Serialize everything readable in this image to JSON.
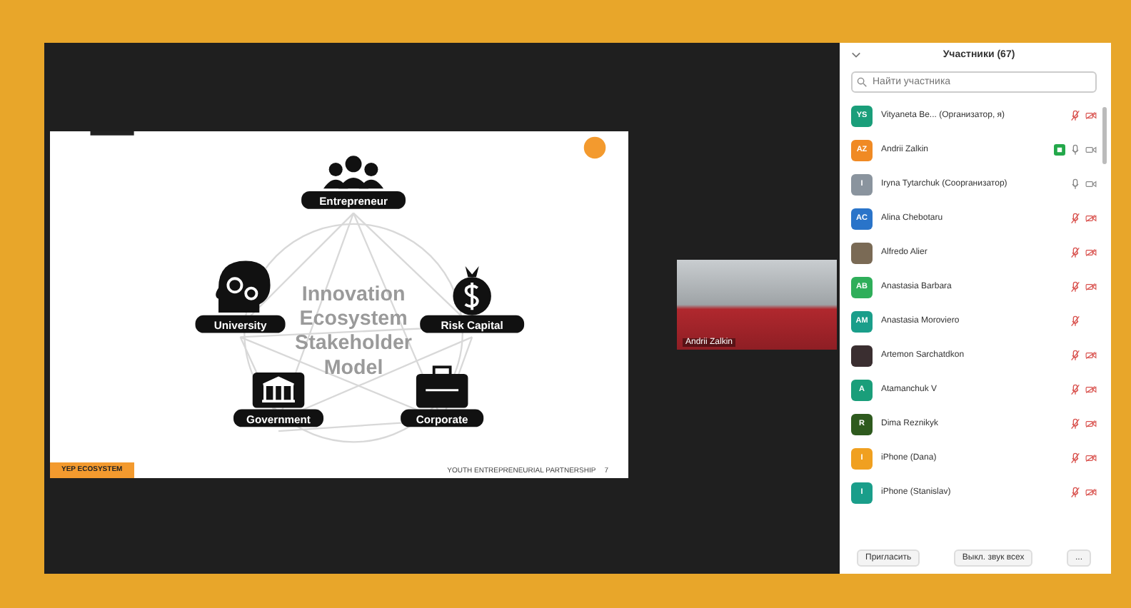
{
  "slide": {
    "title_lines": [
      "Innovation",
      "Ecosystem",
      "Stakeholder",
      "Model"
    ],
    "nodes": [
      {
        "kind": "people",
        "label": "Entrepreneur"
      },
      {
        "kind": "mind",
        "label": "University"
      },
      {
        "kind": "money",
        "label": "Risk Capital"
      },
      {
        "kind": "bank",
        "label": "Government"
      },
      {
        "kind": "case",
        "label": "Corporate"
      }
    ],
    "footer_left": "YEP ECOSYSTEM",
    "footer_right": "YOUTH ENTREPRENEURIAL PARTNERSHIP",
    "page": "7"
  },
  "video": {
    "name": "Andrii Zalkin"
  },
  "participants_panel": {
    "title": "Участники (67)",
    "search": {
      "placeholder": "Найти участника"
    },
    "participants": [
      {
        "initials": "YS",
        "color": "#1a9e7a",
        "name": "Vityaneta Be... (Организатор, я)",
        "sharing": false,
        "muted": true,
        "video_icon": true,
        "video_off": true
      },
      {
        "initials": "AZ",
        "color": "#f08a24",
        "name": "Andrii Zalkin",
        "sharing": true,
        "muted": false,
        "video_icon": true,
        "video_off": false
      },
      {
        "initials": "I",
        "color": "#8a949e",
        "name": "Iryna Tytarchuk (Соорганизатор)",
        "sharing": false,
        "muted": false,
        "video_icon": true,
        "video_off": false
      },
      {
        "initials": "AC",
        "color": "#2a74c9",
        "name": "Alina Chebotaru",
        "sharing": false,
        "muted": true,
        "video_icon": true,
        "video_off": true
      },
      {
        "color": "#7a6a55",
        "name": "Alfredo Alier",
        "sharing": false,
        "muted": true,
        "video_icon": true,
        "video_off": true
      },
      {
        "initials": "AB",
        "color": "#2fae5a",
        "name": "Anastasia Barbara",
        "sharing": false,
        "muted": true,
        "video_icon": true,
        "video_off": true
      },
      {
        "initials": "AM",
        "color": "#1a9e8a",
        "name": "Anastasia Moroviero",
        "sharing": false,
        "muted": true,
        "video_icon": false
      },
      {
        "color": "#3a2e30",
        "name": "Artemon Sarchatdkon",
        "sharing": false,
        "muted": true,
        "video_icon": true,
        "video_off": true
      },
      {
        "initials": "A",
        "color": "#1a9e7a",
        "name": "Atamanchuk V",
        "sharing": false,
        "muted": true,
        "video_icon": true,
        "video_off": true
      },
      {
        "initials": "R",
        "color": "#2e5a1e",
        "name": "Dima Reznikyk",
        "sharing": false,
        "muted": true,
        "video_icon": true,
        "video_off": true
      },
      {
        "initials": "I",
        "color": "#f0a020",
        "name": "iPhone (Dana)",
        "sharing": false,
        "muted": true,
        "video_icon": true,
        "video_off": true
      },
      {
        "initials": "I",
        "color": "#1a9e8a",
        "name": "iPhone (Stanislav)",
        "sharing": false,
        "muted": true,
        "video_icon": true,
        "video_off": true
      }
    ],
    "buttons": [
      "Пригласить",
      "Выкл. звук всех",
      "..."
    ]
  }
}
